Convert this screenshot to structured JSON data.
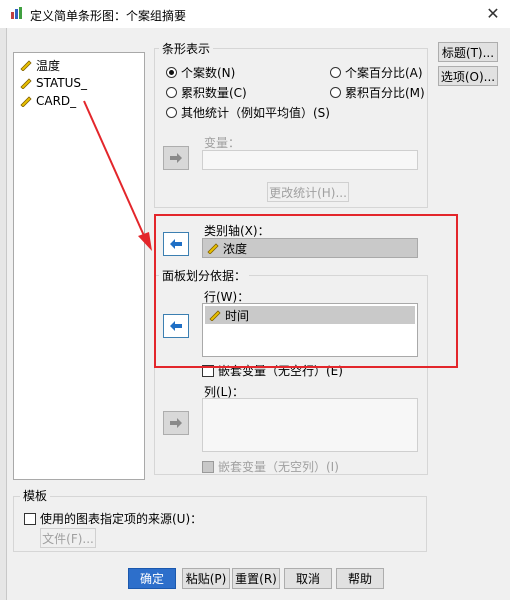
{
  "window": {
    "title": "定义简单条形图：个案组摘要"
  },
  "variables": [
    {
      "name": "温度",
      "icon": "ruler-icon"
    },
    {
      "name": "STATUS_",
      "icon": "ruler-icon"
    },
    {
      "name": "CARD_",
      "icon": "ruler-icon"
    }
  ],
  "bars_represent": {
    "label": "条形表示",
    "options": [
      {
        "label": "个案数(N)",
        "selected": true
      },
      {
        "label": "个案百分比(A)",
        "selected": false
      },
      {
        "label": "累积数量(C)",
        "selected": false
      },
      {
        "label": "累积百分比(M)",
        "selected": false
      },
      {
        "label": "其他统计（例如平均值）(S)",
        "selected": false
      }
    ],
    "variable_label": "变量：",
    "change_stat_button": "更改统计(H)..."
  },
  "category_axis": {
    "label": "类别轴(X)：",
    "value": "浓度"
  },
  "panel_by": {
    "label": "面板划分依据：",
    "rows_label": "行(W)：",
    "rows_values": [
      "时间"
    ],
    "nest_rows_label": "嵌套变量（无空行）(E)",
    "columns_label": "列(L)：",
    "nest_columns_label": "嵌套变量（无空列）(I)"
  },
  "template": {
    "label": "模板",
    "use_chart_spec_label": "使用的图表指定项的来源(U)：",
    "file_button": "文件(F)..."
  },
  "side_buttons": {
    "titles": "标题(T)...",
    "options": "选项(O)..."
  },
  "bottom_buttons": {
    "ok": "确定",
    "paste": "粘贴(P)",
    "reset": "重置(R)",
    "cancel": "取消",
    "help": "帮助"
  },
  "colors": {
    "annotation_red": "#e3262b",
    "primary_blue": "#2d6fcb",
    "arrow_blue": "#1f6fc5"
  }
}
